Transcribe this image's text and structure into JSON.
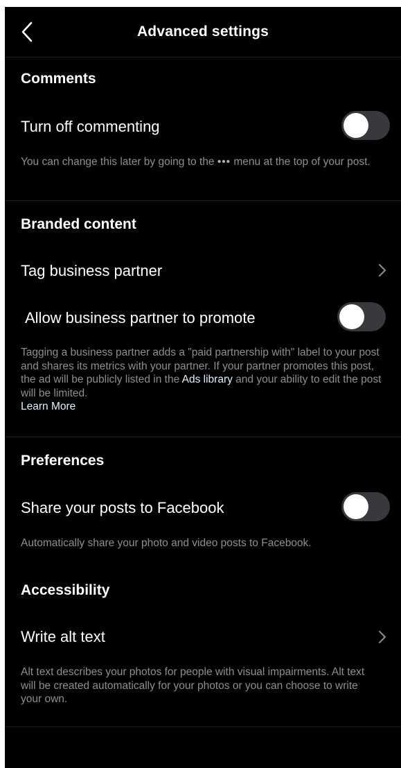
{
  "header": {
    "title": "Advanced settings",
    "back_icon": "chevron-left-icon"
  },
  "comments": {
    "title": "Comments",
    "turn_off_label": "Turn off commenting",
    "turn_off_enabled": false,
    "help_text_before": "You can change this later by going to the ",
    "help_text_menu_glyph": "•••",
    "help_text_after": " menu at the top of your post."
  },
  "branded_content": {
    "title": "Branded content",
    "tag_partner_label": "Tag business partner",
    "allow_promote_label": "Allow business partner to promote",
    "allow_promote_enabled": false,
    "help_text_before": "Tagging a business partner adds a \"paid partnership with\" label to your post and shares its metrics with your partner. If your partner promotes this post, the ad will be publicly listed in the ",
    "ads_library_link": "Ads library",
    "help_text_after": " and your ability to edit the post will be limited.",
    "learn_more_link": "Learn More"
  },
  "preferences": {
    "title": "Preferences",
    "share_facebook_label": "Share your posts to Facebook",
    "share_facebook_enabled": false,
    "help_text": "Automatically share your photo and video posts to Facebook."
  },
  "accessibility": {
    "title": "Accessibility",
    "alt_text_label": "Write alt text",
    "help_text": "Alt text describes your photos for people with visual impairments. Alt text will be created automatically for your photos or you can choose to write your own."
  },
  "colors": {
    "background": "#000000",
    "text": "#ffffff",
    "secondary_text": "#8e8e93",
    "toggle_off_track": "#39393d",
    "link": "#e0f1ff"
  }
}
